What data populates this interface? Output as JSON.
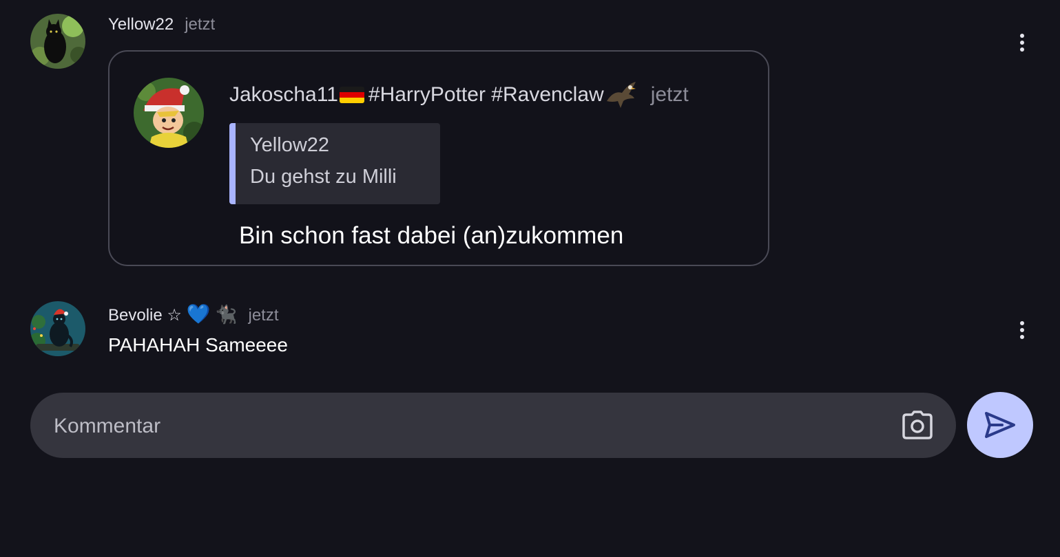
{
  "comments": [
    {
      "author": "Yellow22",
      "time": "jetzt",
      "avatar_icon": "black-cat-avatar",
      "embedded_screenshot": {
        "author_name": "Jakoscha11",
        "author_tags": "#HarryPotter #Ravenclaw",
        "author_flag_icon": "german-flag-icon",
        "author_bird_icon": "eagle-icon",
        "time": "jetzt",
        "quote": {
          "author": "Yellow22",
          "text": "Du gehst zu Milli"
        },
        "message": "Bin schon fast dabei (an)zukommen"
      }
    },
    {
      "author": "Bevolie ☆",
      "author_emojis": [
        "💙",
        "🐈‍⬛"
      ],
      "time": "jetzt",
      "avatar_icon": "cat-christmas-avatar",
      "text": "PAHAHAH Sameeee"
    }
  ],
  "composer": {
    "placeholder": "Kommentar",
    "camera_icon": "camera-icon",
    "send_icon": "send-icon"
  },
  "colors": {
    "background": "#13131b",
    "input_background": "#35353e",
    "send_button": "#bfc8ff",
    "send_icon": "#2a3a8a",
    "quote_bar": "#a9b4ff"
  }
}
